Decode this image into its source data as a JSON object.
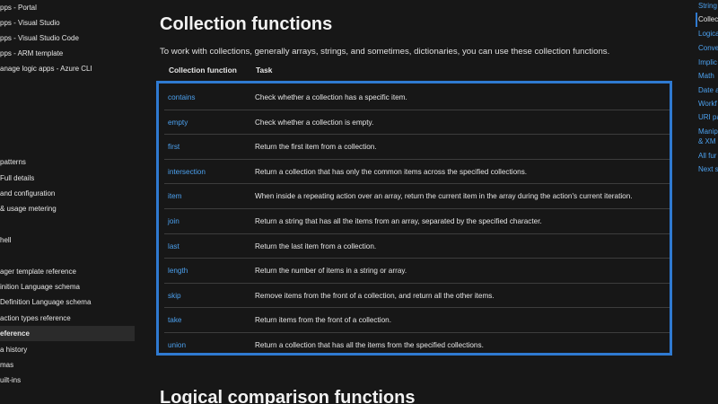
{
  "left_nav": {
    "items": [
      {
        "label": "pps - Portal",
        "active": false
      },
      {
        "label": "pps - Visual Studio",
        "active": false
      },
      {
        "label": "pps - Visual Studio Code",
        "active": false
      },
      {
        "label": "pps - ARM template",
        "active": false
      },
      {
        "label": "anage logic apps - Azure CLI",
        "active": false
      },
      {
        "label": "patterns",
        "active": false
      },
      {
        "label": "Full details",
        "active": false
      },
      {
        "label": "and configuration",
        "active": false
      },
      {
        "label": "& usage metering",
        "active": false
      },
      {
        "label": "hell",
        "active": false
      },
      {
        "label": "ager template reference",
        "active": false
      },
      {
        "label": "inition Language schema",
        "active": false
      },
      {
        "label": "Definition Language schema",
        "active": false
      },
      {
        "label": "action types reference",
        "active": false
      },
      {
        "label": "eference",
        "active": true
      },
      {
        "label": "a history",
        "active": false
      },
      {
        "label": "mas",
        "active": false
      },
      {
        "label": "uilt-ins",
        "active": false
      }
    ]
  },
  "right_nav": {
    "items": [
      {
        "label": "String",
        "active": false
      },
      {
        "label": "Collec",
        "active": true
      },
      {
        "label": "Logica",
        "active": false
      },
      {
        "label": "Conve",
        "active": false
      },
      {
        "label": "Implic",
        "active": false
      },
      {
        "label": "Math",
        "active": false
      },
      {
        "label": "Date a",
        "active": false
      },
      {
        "label": "Workf",
        "active": false
      },
      {
        "label": "URI pa",
        "active": false
      },
      {
        "label": "Manip",
        "active": false
      },
      {
        "label": "& XM",
        "active": false
      },
      {
        "label": "All fur",
        "active": false
      },
      {
        "label": "Next s",
        "active": false
      }
    ]
  },
  "main": {
    "title": "Collection functions",
    "intro": "To work with collections, generally arrays, strings, and sometimes, dictionaries, you can use these collection functions.",
    "table": {
      "headers": {
        "function": "Collection function",
        "task": "Task"
      },
      "rows": [
        {
          "function": "contains",
          "task": "Check whether a collection has a specific item."
        },
        {
          "function": "empty",
          "task": "Check whether a collection is empty."
        },
        {
          "function": "first",
          "task": "Return the first item from a collection."
        },
        {
          "function": "intersection",
          "task": "Return a collection that has only the common items across the specified collections."
        },
        {
          "function": "item",
          "task": "When inside a repeating action over an array, return the current item in the array during the action's current iteration."
        },
        {
          "function": "join",
          "task": "Return a string that has all the items from an array, separated by the specified character."
        },
        {
          "function": "last",
          "task": "Return the last item from a collection."
        },
        {
          "function": "length",
          "task": "Return the number of items in a string or array."
        },
        {
          "function": "skip",
          "task": "Remove items from the front of a collection, and return all the other items."
        },
        {
          "function": "take",
          "task": "Return items from the front of a collection."
        },
        {
          "function": "union",
          "task": "Return a collection that has all the items from the specified collections."
        }
      ]
    },
    "next_heading": "Logical comparison functions"
  },
  "colors": {
    "background": "#171717",
    "link": "#4ca1ef",
    "highlight_border": "#2f7ad1"
  }
}
